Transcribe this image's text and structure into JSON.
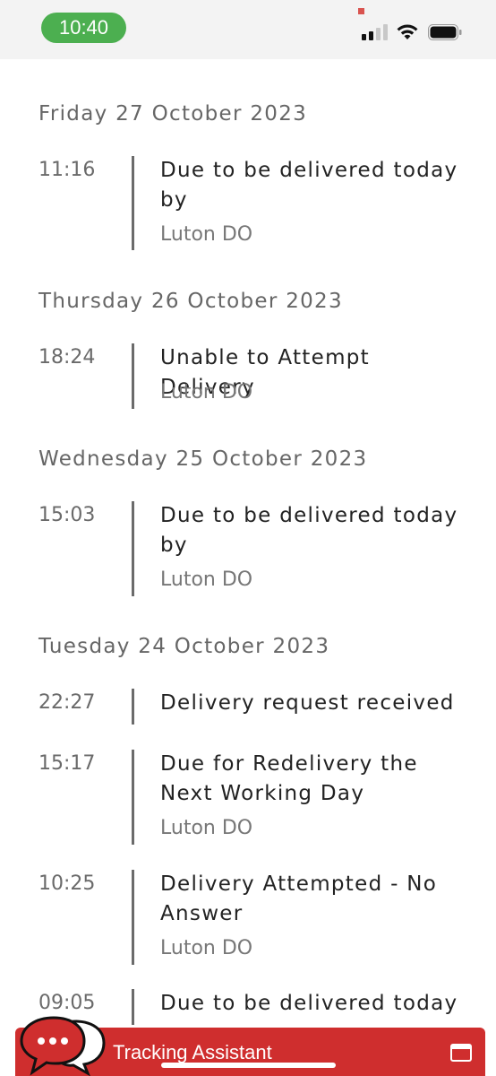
{
  "status_bar": {
    "time": "10:40"
  },
  "timeline": {
    "days": [
      {
        "heading": "Friday 27 October 2023",
        "events": [
          {
            "time": "11:16",
            "title": "Due to be delivered today by",
            "location": "Luton DO"
          }
        ]
      },
      {
        "heading": "Thursday 26 October 2023",
        "events": [
          {
            "time": "18:24",
            "title": "Unable to Attempt Delivery",
            "location": "Luton DO"
          }
        ]
      },
      {
        "heading": "Wednesday 25 October 2023",
        "events": [
          {
            "time": "15:03",
            "title": "Due to be delivered today by",
            "location": "Luton DO"
          }
        ]
      },
      {
        "heading": "Tuesday 24 October 2023",
        "events": [
          {
            "time": "22:27",
            "title": "Delivery request received",
            "location": ""
          },
          {
            "time": "15:17",
            "title": "Due for Redelivery the Next Working Day",
            "location": "Luton DO"
          },
          {
            "time": "10:25",
            "title": "Delivery Attempted - No Answer",
            "location": "Luton DO"
          },
          {
            "time": "09:05",
            "title": "Due to be delivered today",
            "location": ""
          }
        ]
      }
    ]
  },
  "assistant": {
    "label": "Tracking Assistant"
  },
  "colors": {
    "accent_red": "#cf2e2e",
    "pill_green": "#4caf50"
  }
}
